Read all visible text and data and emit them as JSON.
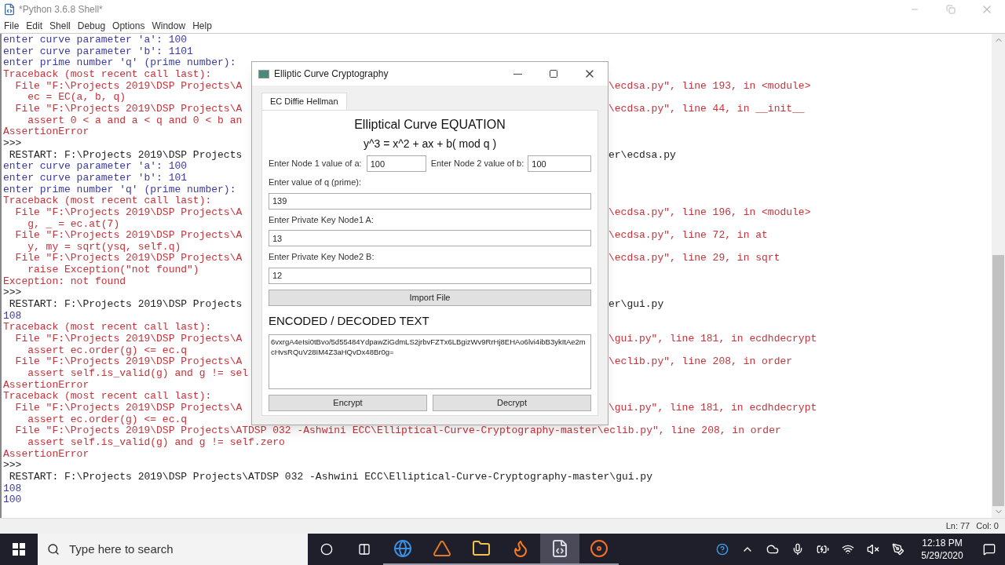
{
  "shell": {
    "title": "*Python 3.6.8 Shell*",
    "menu": [
      "File",
      "Edit",
      "Shell",
      "Debug",
      "Options",
      "Window",
      "Help"
    ],
    "lines": [
      {
        "kind": "output",
        "text": "enter curve parameter 'a': 100"
      },
      {
        "kind": "output",
        "text": "enter curve parameter 'b': 1101"
      },
      {
        "kind": "output",
        "text": "enter prime number 'q' (prime number):"
      },
      {
        "kind": "error",
        "text": "Traceback (most recent call last):"
      },
      {
        "kind": "error",
        "text": "  File \"F:\\Projects 2019\\DSP Projects\\A",
        "right": "\\ecdsa.py\", line 193, in <module>"
      },
      {
        "kind": "error",
        "text": "    ec = EC(a, b, q)"
      },
      {
        "kind": "error",
        "text": "  File \"F:\\Projects 2019\\DSP Projects\\A",
        "right": "\\ecdsa.py\", line 44, in __init__"
      },
      {
        "kind": "error",
        "text": "    assert 0 < a and a < q and 0 < b an"
      },
      {
        "kind": "error",
        "text": "AssertionError"
      },
      {
        "kind": "plain",
        "text": ">>>"
      },
      {
        "kind": "plain",
        "text": " RESTART: F:\\Projects 2019\\DSP Projects",
        "right": "er\\ecdsa.py"
      },
      {
        "kind": "output",
        "text": "enter curve parameter 'a': 100"
      },
      {
        "kind": "output",
        "text": "enter curve parameter 'b': 101"
      },
      {
        "kind": "output",
        "text": "enter prime number 'q' (prime number):"
      },
      {
        "kind": "error",
        "text": "Traceback (most recent call last):"
      },
      {
        "kind": "error",
        "text": "  File \"F:\\Projects 2019\\DSP Projects\\A",
        "right": "\\ecdsa.py\", line 196, in <module>"
      },
      {
        "kind": "error",
        "text": "    g, _ = ec.at(7)"
      },
      {
        "kind": "error",
        "text": "  File \"F:\\Projects 2019\\DSP Projects\\A",
        "right": "\\ecdsa.py\", line 72, in at"
      },
      {
        "kind": "error",
        "text": "    y, my = sqrt(ysq, self.q)"
      },
      {
        "kind": "error",
        "text": "  File \"F:\\Projects 2019\\DSP Projects\\A",
        "right": "\\ecdsa.py\", line 29, in sqrt"
      },
      {
        "kind": "error",
        "text": "    raise Exception(\"not found\")"
      },
      {
        "kind": "error",
        "text": "Exception: not found"
      },
      {
        "kind": "plain",
        "text": ">>>"
      },
      {
        "kind": "plain",
        "text": " RESTART: F:\\Projects 2019\\DSP Projects",
        "right": "er\\gui.py"
      },
      {
        "kind": "output",
        "text": "108"
      },
      {
        "kind": "error",
        "text": "Traceback (most recent call last):"
      },
      {
        "kind": "error",
        "text": "  File \"F:\\Projects 2019\\DSP Projects\\A",
        "right": "\\gui.py\", line 181, in ecdhdecrypt"
      },
      {
        "kind": "error",
        "text": "    assert ec.order(g) <= ec.q"
      },
      {
        "kind": "error",
        "text": "  File \"F:\\Projects 2019\\DSP Projects\\A",
        "right": "\\eclib.py\", line 208, in order"
      },
      {
        "kind": "error",
        "text": "    assert self.is_valid(g) and g != sel"
      },
      {
        "kind": "error",
        "text": "AssertionError"
      },
      {
        "kind": "error",
        "text": "Traceback (most recent call last):"
      },
      {
        "kind": "error",
        "text": "  File \"F:\\Projects 2019\\DSP Projects\\A",
        "right": "\\gui.py\", line 181, in ecdhdecrypt"
      },
      {
        "kind": "error",
        "text": "    assert ec.order(g) <= ec.q"
      },
      {
        "kind": "error",
        "text": "  File \"F:\\Projects 2019\\DSP Projects\\ATDSP 032 -Ashwini ECC\\Elliptical-Curve-Cryptography-master\\eclib.py\", line 208, in order"
      },
      {
        "kind": "error",
        "text": "    assert self.is_valid(g) and g != self.zero"
      },
      {
        "kind": "error",
        "text": "AssertionError"
      },
      {
        "kind": "plain",
        "text": ">>>"
      },
      {
        "kind": "plain",
        "text": " RESTART: F:\\Projects 2019\\DSP Projects\\ATDSP 032 -Ashwini ECC\\Elliptical-Curve-Cryptography-master\\gui.py"
      },
      {
        "kind": "output",
        "text": "108"
      },
      {
        "kind": "output",
        "text": "100"
      }
    ],
    "status": {
      "line": "Ln: 77",
      "column": "Col: 0"
    }
  },
  "dialog": {
    "title": "Elliptic Curve Cryptography",
    "tabs": [
      {
        "label": "EC Diffie Hellman",
        "selected": true
      }
    ],
    "heading": "Elliptical Curve EQUATION",
    "equation": "y^3 = x^2 + ax + b( mod q )",
    "pair": [
      {
        "label": "Enter Node 1 value of a:",
        "value": "100"
      },
      {
        "label": "Enter Node 2 value of b:",
        "value": "100"
      }
    ],
    "fields": [
      {
        "label": "Enter value of q (prime):",
        "value": "139"
      },
      {
        "label": "Enter Private Key Node1  A:",
        "value": "13"
      },
      {
        "label": "Enter Private Key Node2 B:",
        "value": "12"
      }
    ],
    "import_button": "Import File",
    "output_heading": "ENCODED / DECODED TEXT",
    "output_text": "6vxrgA4eIsi0tBvo/5d55484YdpawZiGdmLS2jrbvFZTx6LBgizWv9RrHj8EHAo6lvi4ibB3ykItAe2mcHvsRQuV28IM4Z3aHQvDx48Br0g=",
    "buttons": [
      "Encrypt",
      "Decrypt"
    ]
  },
  "taskbar": {
    "search_placeholder": "Type here to search",
    "apps": [
      {
        "kind": "browser",
        "selected": false
      },
      {
        "kind": "math",
        "selected": false
      },
      {
        "kind": "folder",
        "selected": false
      },
      {
        "kind": "fox",
        "selected": false
      },
      {
        "kind": "python",
        "selected": true
      },
      {
        "kind": "recorder",
        "selected": false
      }
    ],
    "time": "12:18 PM",
    "date": "5/29/2020"
  }
}
